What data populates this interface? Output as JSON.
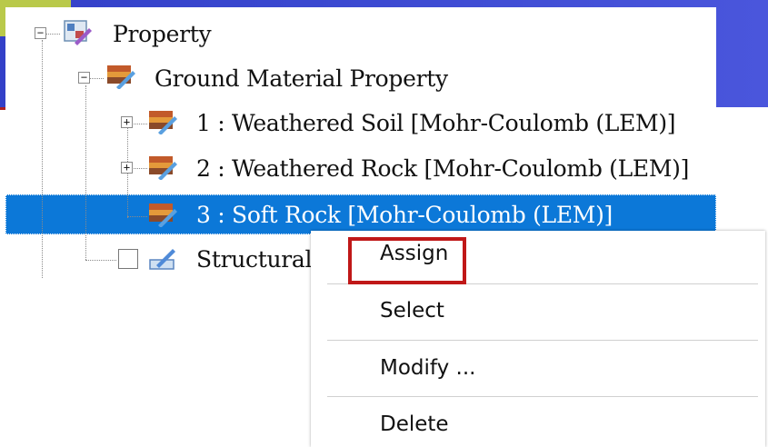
{
  "tree": {
    "nodes": [
      {
        "label": "Property"
      },
      {
        "label": "Ground Material Property"
      },
      {
        "label": "1 : Weathered Soil [Mohr-Coulomb (LEM)]"
      },
      {
        "label": "2 : Weathered Rock [Mohr-Coulomb (LEM)]"
      },
      {
        "label": "3 : Soft Rock [Mohr-Coulomb (LEM)]"
      },
      {
        "label": "Structural F"
      }
    ],
    "expanders": {
      "collapse": "−",
      "expand": "+"
    },
    "selected_color": "#0c78d8"
  },
  "context_menu": {
    "items": [
      {
        "label": "Assign"
      },
      {
        "label": "Select"
      },
      {
        "label": "Modify ..."
      },
      {
        "label": "Delete"
      }
    ],
    "highlight_color": "#c01818"
  },
  "icons": {
    "property": "property-icon",
    "material": "material-icon",
    "structural": "structural-icon"
  }
}
